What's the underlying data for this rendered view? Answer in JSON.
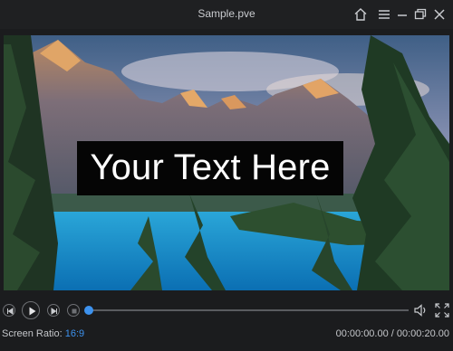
{
  "window": {
    "title": "Sample.pve",
    "controls": [
      "home-icon",
      "menu-icon",
      "minimize-icon",
      "restore-icon",
      "close-icon"
    ]
  },
  "preview": {
    "overlay_text": "Your Text Here",
    "overlay_bg": "#050505"
  },
  "player": {
    "buttons": [
      "previous-frame-icon",
      "play-icon",
      "next-frame-icon",
      "stop-icon"
    ],
    "progress": 0,
    "accent": "#3d92ee",
    "time_display": "00:00:00.00 / 00:00:20.00",
    "ratio_label": "Screen Ratio:",
    "ratio_value": "16:9"
  }
}
